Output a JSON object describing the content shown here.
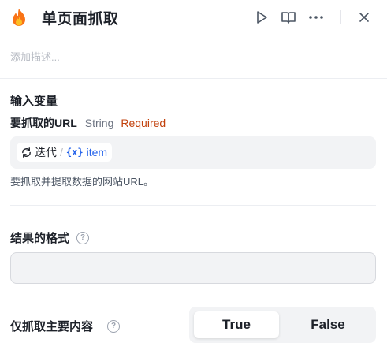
{
  "header": {
    "title": "单页面抓取",
    "app_icon": "fire-icon",
    "actions": [
      {
        "name": "run",
        "icon": "play-icon"
      },
      {
        "name": "docs",
        "icon": "book-icon"
      },
      {
        "name": "more",
        "icon": "more-icon"
      },
      {
        "name": "close",
        "icon": "close-icon"
      }
    ]
  },
  "description": {
    "placeholder": "添加描述..."
  },
  "inputs": {
    "section_title": "输入变量",
    "variable": {
      "name": "要抓取的URL",
      "type": "String",
      "required": "Required",
      "value_chip": {
        "icon": "loop-icon",
        "label": "迭代",
        "separator": "/",
        "var_icon": "{x}",
        "var_name": "item"
      },
      "hint": "要抓取并提取数据的网站URL。"
    }
  },
  "result_format": {
    "label": "结果的格式",
    "help_icon": "?",
    "value": ""
  },
  "main_content_only": {
    "label": "仅抓取主要内容",
    "help_icon": "?",
    "options": [
      "True",
      "False"
    ],
    "selected": "True"
  },
  "colors": {
    "required": "#c2410c",
    "variable": "#2563eb",
    "input_bg": "#f2f3f5",
    "flame_outer": "#f97316",
    "flame_inner": "#fbbf24"
  }
}
